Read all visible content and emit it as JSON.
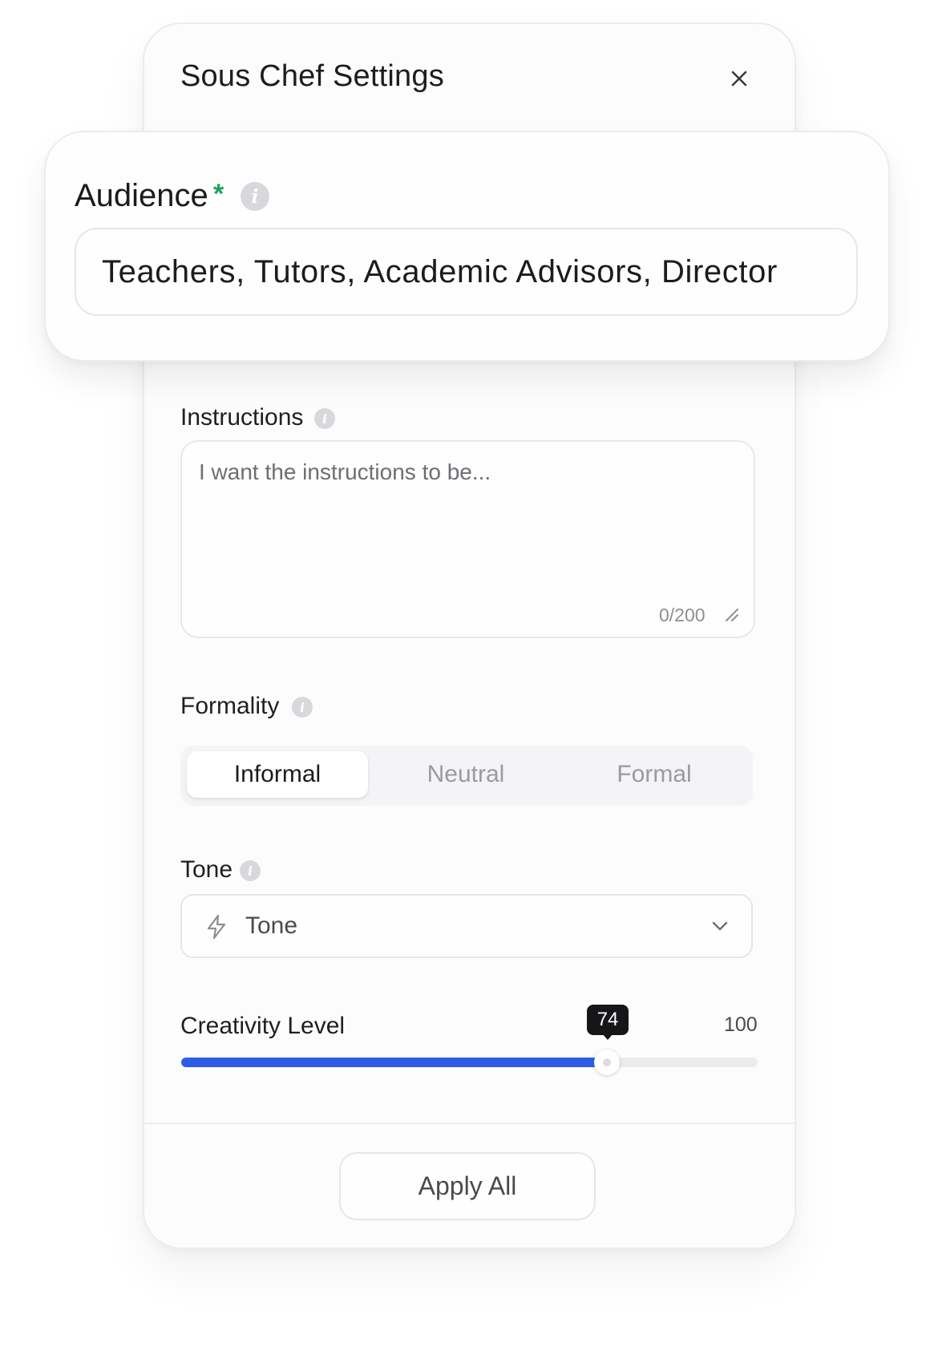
{
  "panel": {
    "title": "Sous Chef Settings"
  },
  "audience": {
    "label": "Audience",
    "required_mark": "*",
    "value": "Teachers, Tutors, Academic Advisors, Director"
  },
  "instructions": {
    "label": "Instructions",
    "placeholder": "I want the instructions to be...",
    "char_count": "0/200"
  },
  "formality": {
    "label": "Formality",
    "options": [
      "Informal",
      "Neutral",
      "Formal"
    ],
    "selected": "Informal"
  },
  "tone": {
    "label": "Tone",
    "value": "Tone",
    "icon": "bolt-icon"
  },
  "creativity": {
    "label": "Creativity Level",
    "value": 74,
    "value_text": "74",
    "max": 100,
    "max_text": "100"
  },
  "footer": {
    "apply_label": "Apply All"
  },
  "colors": {
    "accent": "#2d5de8",
    "required": "#1aa35a",
    "tooltip_bg": "#161618"
  },
  "info_glyph": "i"
}
